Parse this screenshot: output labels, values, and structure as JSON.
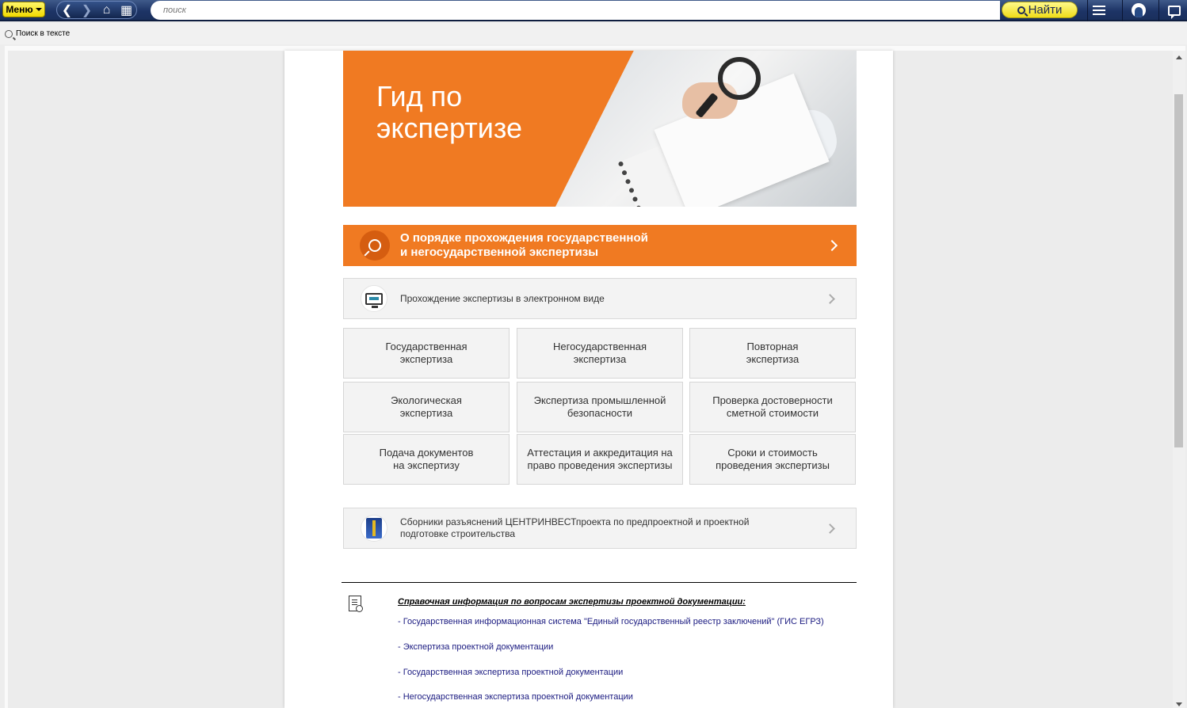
{
  "toolbar": {
    "menu_label": "Меню",
    "search_placeholder": "поиск",
    "find_label": "Найти",
    "icons": [
      "back-icon",
      "forward-icon",
      "home-icon",
      "grid-icon",
      "hamburger-icon",
      "user-icon",
      "chat-icon"
    ]
  },
  "subbar": {
    "find_in_text_label": "Поиск в тексте"
  },
  "hero": {
    "title_line1": "Гид по",
    "title_line2": "экспертизе"
  },
  "orange_link": {
    "line1": "О порядке прохождения государственной",
    "line2": "и негосударственной экспертизы"
  },
  "electronic_link": {
    "label": "Прохождение экспертизы в электронном виде"
  },
  "tiles": [
    {
      "line1": "Государственная",
      "line2": "экспертиза"
    },
    {
      "line1": "Негосударственная",
      "line2": "экспертиза"
    },
    {
      "line1": "Повторная",
      "line2": "экспертиза"
    },
    {
      "line1": "Экологическая",
      "line2": "экспертиза"
    },
    {
      "line1": "Экспертиза промышленной",
      "line2": "безопасности"
    },
    {
      "line1": "Проверка достоверности",
      "line2": "сметной стоимости"
    },
    {
      "line1": "Подача документов",
      "line2": "на экспертизу"
    },
    {
      "line1": "Аттестация и аккредитация на",
      "line2": "право проведения экспертизы"
    },
    {
      "line1": "Сроки и стоимость",
      "line2": "проведения экспертизы"
    }
  ],
  "collections_link": {
    "line1": "Сборники разъяснений ЦЕНТРИНВЕСТпроекта по предпроектной и проектной",
    "line2": "подготовке строительства"
  },
  "reference": {
    "title": "Справочная информация по вопросам экспертизы проектной документации:",
    "links": [
      "- Государственная информационная система \"Единый государственный реестр заключений\" (ГИС ЕГРЗ)",
      "- Экспертиза проектной документации",
      "- Государственная экспертиза проектной документации",
      "- Негосударственная экспертиза проектной документации"
    ]
  },
  "colors": {
    "accent_orange": "#f07a22",
    "toolbar_navy": "#1d3466",
    "find_yellow": "#efdc1a"
  }
}
